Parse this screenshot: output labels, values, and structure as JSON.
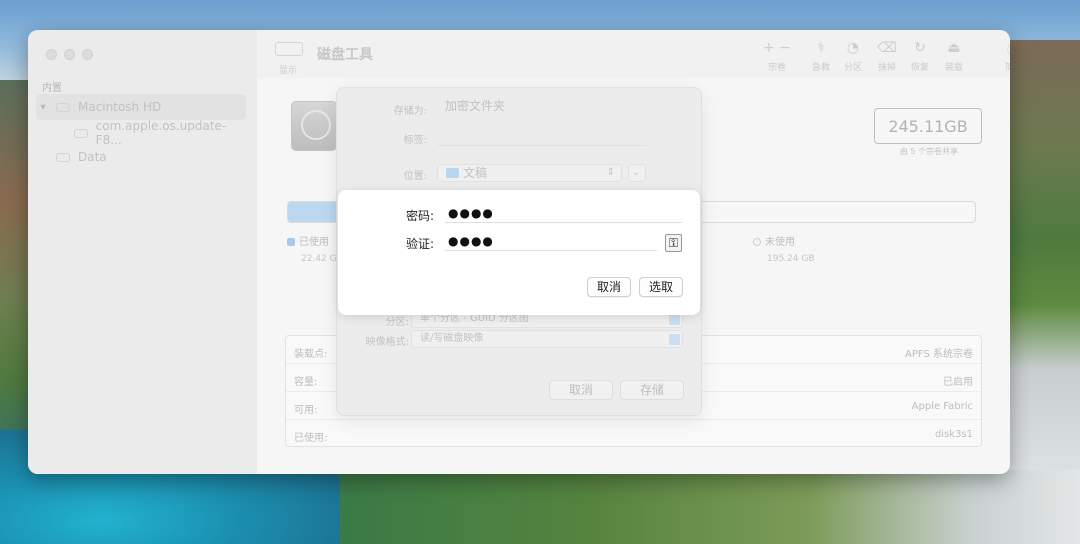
{
  "app": {
    "title": "磁盘工具",
    "view_label": "显示"
  },
  "toolbar": {
    "buttons": [
      {
        "label": "宗卷",
        "icon": "plus-minus-icon"
      },
      {
        "label": "急救",
        "icon": "stethoscope-icon"
      },
      {
        "label": "分区",
        "icon": "pie-icon"
      },
      {
        "label": "抹掉",
        "icon": "eraser-icon"
      },
      {
        "label": "恢复",
        "icon": "restore-icon"
      },
      {
        "label": "装载",
        "icon": "eject-icon"
      },
      {
        "label": "简介",
        "icon": "info-icon"
      }
    ]
  },
  "sidebar": {
    "section": "内置",
    "items": [
      {
        "label": "Macintosh HD"
      },
      {
        "label": "com.apple.os.update-F8..."
      },
      {
        "label": "Data"
      }
    ]
  },
  "disk": {
    "capacity": "245.11GB",
    "capacity_sub": "由 5 个宗卷共享",
    "used_fraction": 0.092,
    "legend_used": "已使用",
    "used_value": "22.42 G",
    "legend_free": "未使用",
    "free_value": "195.24 GB"
  },
  "info_rows": [
    {
      "key": "装载点:",
      "value": "APFS 系统宗卷"
    },
    {
      "key": "容量:",
      "value": "已启用"
    },
    {
      "key": "可用:",
      "value": "Apple Fabric"
    },
    {
      "key": "已使用:",
      "value": "disk3s1"
    }
  ],
  "save_sheet": {
    "save_as_label": "存储为:",
    "save_as_value": "加密文件夹",
    "tags_label": "标签:",
    "location_label": "位置:",
    "location_value": "文稿",
    "partition_label": "分区:",
    "partition_value": "单个分区 - GUID 分区图",
    "format_label": "映像格式:",
    "format_value": "读/写磁盘映像",
    "cancel": "取消",
    "save": "存储"
  },
  "password_dialog": {
    "password_label": "密码:",
    "password_value": "●●●●",
    "verify_label": "验证:",
    "verify_value": "●●●●",
    "key_icon": "key-icon",
    "cancel": "取消",
    "choose": "选取"
  },
  "colors": {
    "usage_fill": "#bcd7ef",
    "dialog_bg": "#ffffff"
  }
}
